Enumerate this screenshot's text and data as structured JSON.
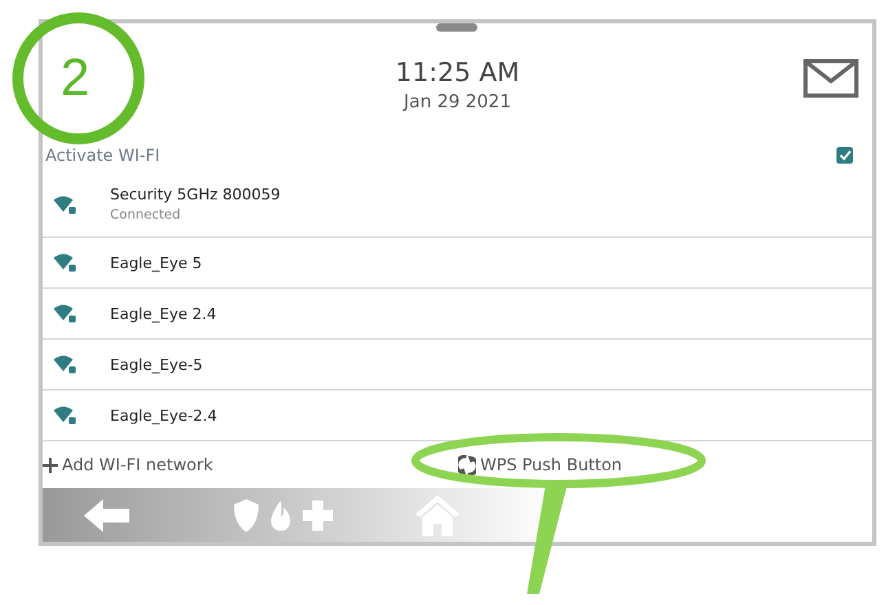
{
  "header": {
    "time": "11:25 AM",
    "date": "Jan 29 2021"
  },
  "activate_wifi": {
    "label": "Activate WI-FI",
    "checked": true
  },
  "networks": [
    {
      "name": "Security 5GHz 800059",
      "status": "Connected"
    },
    {
      "name": "Eagle_Eye 5"
    },
    {
      "name": "Eagle_Eye 2.4"
    },
    {
      "name": "Eagle_Eye-5"
    },
    {
      "name": "Eagle_Eye-2.4"
    }
  ],
  "actions": [
    {
      "kind": "add",
      "label": "Add WI-FI network"
    },
    {
      "kind": "wps",
      "label": "WPS Push Button"
    }
  ],
  "annotation": {
    "step": "2"
  }
}
